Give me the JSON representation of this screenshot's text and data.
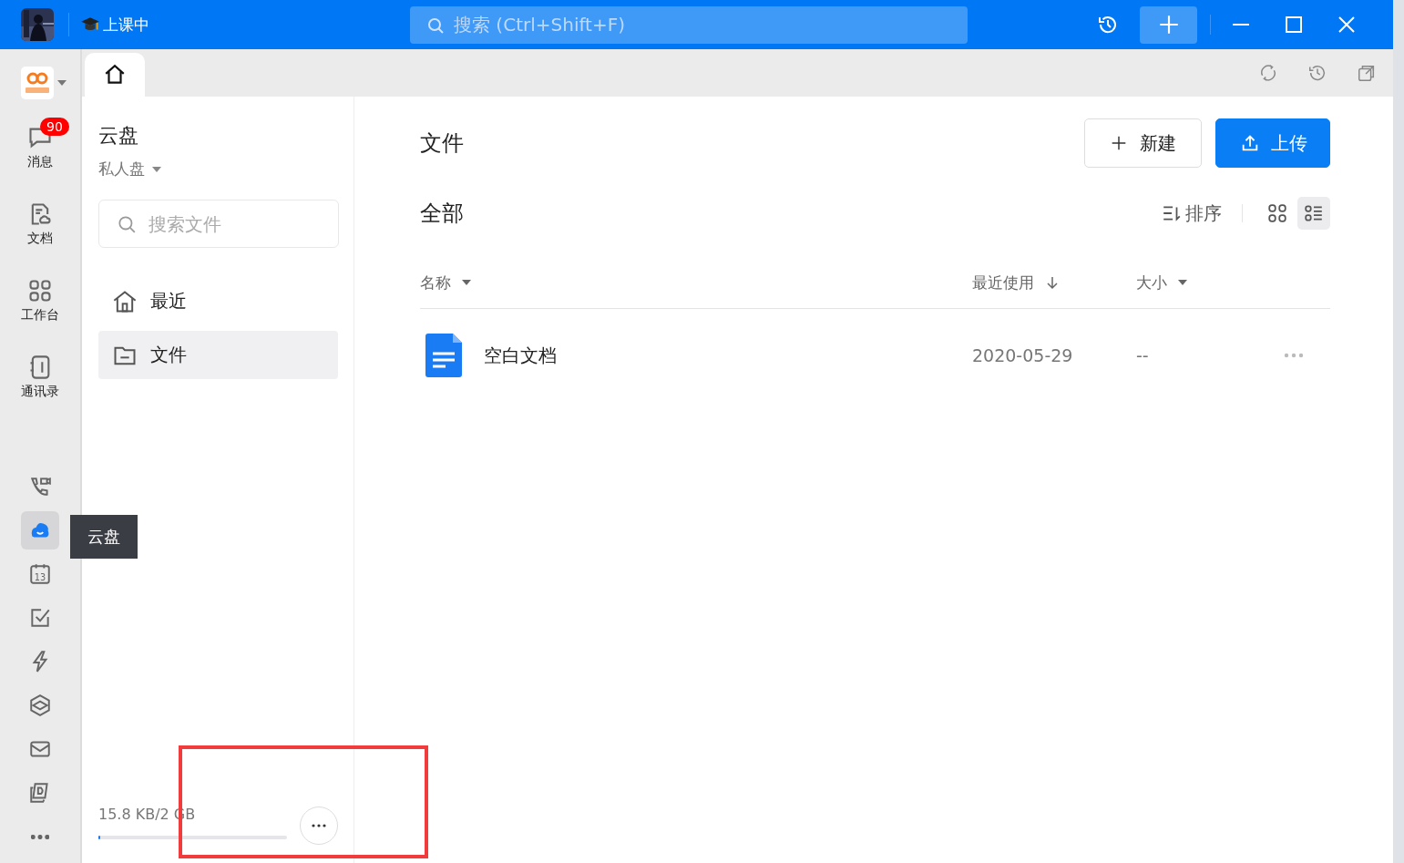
{
  "titlebar": {
    "status": "上课中",
    "search_placeholder": "搜索 (Ctrl+Shift+F)"
  },
  "nav": [
    {
      "label": "消息",
      "badge": "90"
    },
    {
      "label": "文档"
    },
    {
      "label": "工作台"
    },
    {
      "label": "通讯录"
    }
  ],
  "nav_icons": [
    {
      "selected": false
    },
    {
      "selected": true
    },
    {
      "selected": false
    },
    {
      "selected": false
    },
    {
      "selected": false
    },
    {
      "selected": false
    },
    {
      "selected": false
    },
    {
      "selected": false
    },
    {
      "selected": false
    }
  ],
  "tooltip": "云盘",
  "calendar_day": "13",
  "panel": {
    "title": "云盘",
    "drive": "私人盘",
    "search_placeholder": "搜索文件",
    "items": [
      {
        "label": "最近",
        "selected": false
      },
      {
        "label": "文件",
        "selected": true
      }
    ],
    "usage": "15.8 KB/2 GB",
    "level": 0.01
  },
  "main": {
    "title": "文件",
    "buttons": [
      {
        "label": "新建",
        "kind": "secondary"
      },
      {
        "label": "上传",
        "kind": "primary"
      }
    ],
    "section": "全部",
    "sort": "排序",
    "views": [
      {
        "selected": false
      },
      {
        "selected": true
      }
    ],
    "columns": [
      {
        "label": "名称",
        "kind": "menu"
      },
      {
        "label": "最近使用",
        "kind": "sorted"
      },
      {
        "label": "大小",
        "kind": "menu"
      }
    ],
    "rows": [
      {
        "name": "空白文档",
        "date": "2020-05-29",
        "size": "--"
      }
    ]
  }
}
